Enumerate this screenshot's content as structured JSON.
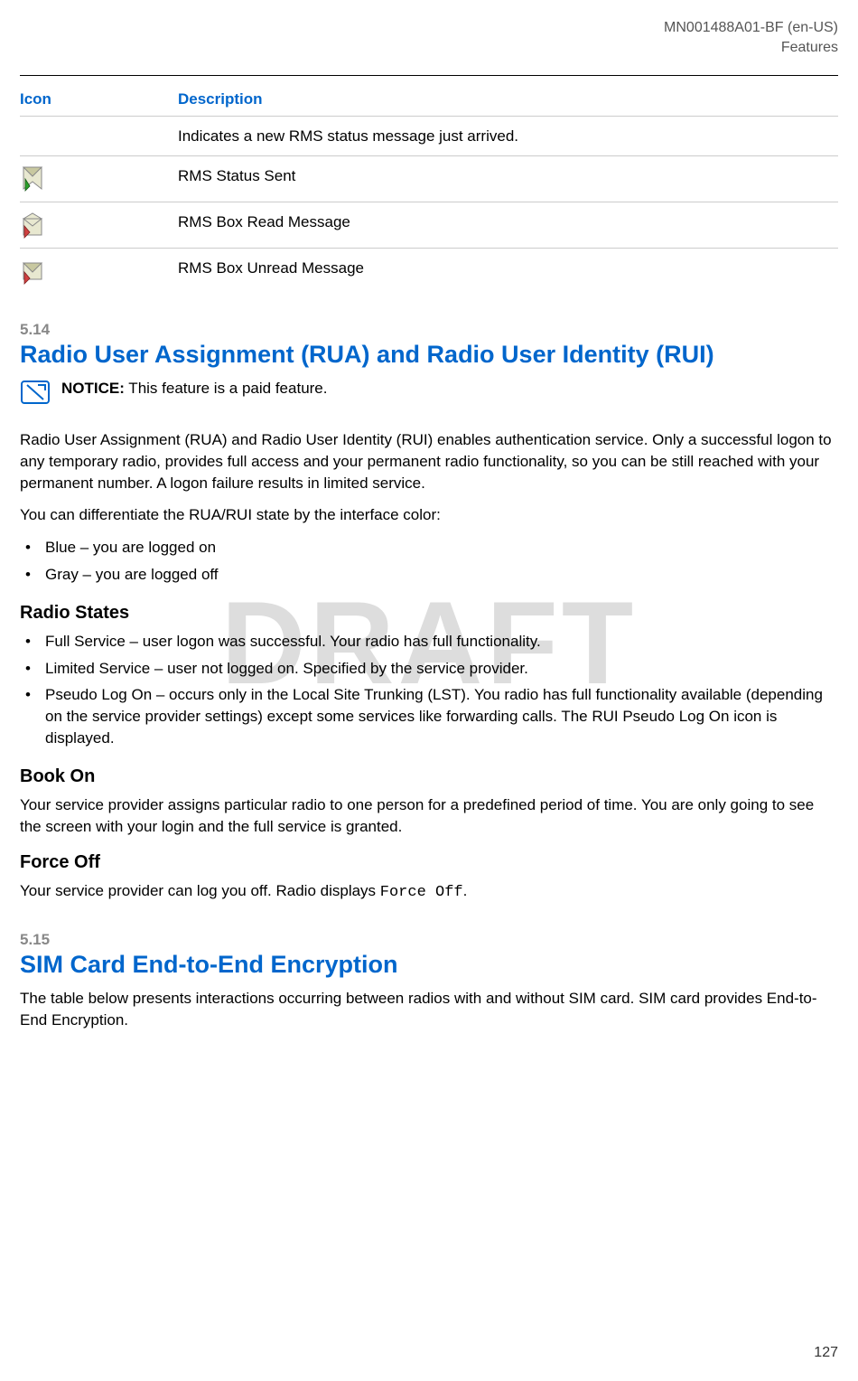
{
  "header": {
    "doc_id": "MN001488A01-BF (en-US)",
    "doc_section": "Features"
  },
  "icon_table": {
    "col1": "Icon",
    "col2": "Description",
    "rows": [
      {
        "desc": "Indicates a new RMS status message just arrived."
      },
      {
        "desc": "RMS Status Sent"
      },
      {
        "desc": "RMS Box Read Message"
      },
      {
        "desc": "RMS Box Unread Message"
      }
    ]
  },
  "section_514": {
    "num": "5.14",
    "title": "Radio User Assignment (RUA) and Radio User Identity (RUI)",
    "notice_label": "NOTICE:",
    "notice_text": " This feature is a paid feature.",
    "para1": "Radio User Assignment (RUA) and Radio User Identity (RUI) enables authentication service. Only a successful logon to any temporary radio, provides full access and your permanent radio functionality, so you can be still reached with your permanent number. A logon failure results in limited service.",
    "para2": "You can differentiate the RUA/RUI state by the interface color:",
    "colors": [
      "Blue – you are logged on",
      "Gray – you are logged off"
    ],
    "radio_states_heading": "Radio States",
    "radio_states": [
      "Full Service – user logon was successful. Your radio has full functionality.",
      "Limited Service – user not logged on. Specified by the service provider.",
      "Pseudo Log On – occurs only in the Local Site Trunking (LST). You radio has full functionality available (depending on the service provider settings) except some services like forwarding calls. The RUI Pseudo Log On icon is displayed."
    ],
    "book_on_heading": "Book On",
    "book_on_para": "Your service provider assigns particular radio to one person for a predefined period of time. You are only going to see the screen with your login and the full service is granted.",
    "force_off_heading": "Force Off",
    "force_off_para_prefix": "Your service provider can log you off. Radio displays ",
    "force_off_code": "Force Off",
    "force_off_para_suffix": "."
  },
  "section_515": {
    "num": "5.15",
    "title": "SIM Card End-to-End Encryption",
    "para1": "The table below presents interactions occurring between radios with and without SIM card. SIM card provides End-to-End Encryption."
  },
  "watermark": "DRAFT",
  "page_number": "127"
}
